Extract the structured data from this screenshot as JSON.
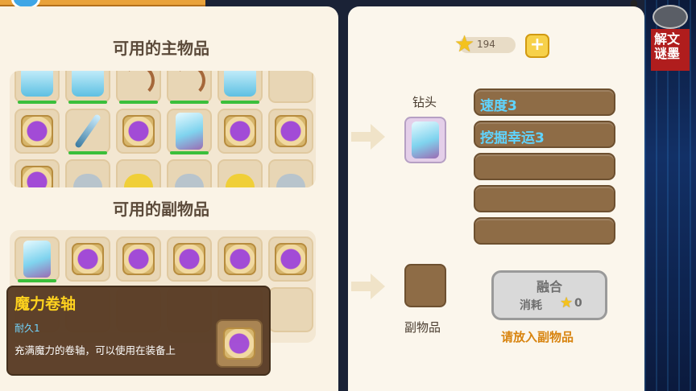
{
  "left": {
    "main_title": "可用的主物品",
    "sub_title": "可用的副物品",
    "main_rows": [
      [
        "armor",
        "armor",
        "bow",
        "bow",
        "armor",
        "empty"
      ],
      [
        "scroll",
        "sword",
        "scroll",
        "drill",
        "scroll",
        "scroll"
      ],
      [
        "scroll",
        "grey",
        "yellow",
        "grey",
        "yellow",
        "grey"
      ]
    ],
    "sub_rows": [
      [
        "drill",
        "scroll",
        "scroll",
        "scroll",
        "scroll",
        "scroll"
      ],
      [
        "empty",
        "empty",
        "empty",
        "empty",
        "empty",
        "empty"
      ]
    ]
  },
  "tooltip": {
    "title": "魔力卷轴",
    "durability": "耐久1",
    "description": "充满魔力的卷轴，可以使用在装备上",
    "icon": "magic-scroll-icon"
  },
  "right": {
    "currency_value": "194",
    "currency_icon": "star-icon",
    "add_icon": "plus-icon",
    "main_item_label": "钻头",
    "sub_item_label": "副物品",
    "attributes": [
      "速度3",
      "挖掘幸运3",
      "",
      "",
      ""
    ],
    "fuse_title": "融合",
    "consume_label": "消耗",
    "consume_value": "0",
    "hint": "请放入副物品"
  },
  "colors": {
    "accent": "#e9a23a",
    "attr_text": "#5fd4ff",
    "hint": "#d88410",
    "tooltip_title": "#ffd21a"
  }
}
